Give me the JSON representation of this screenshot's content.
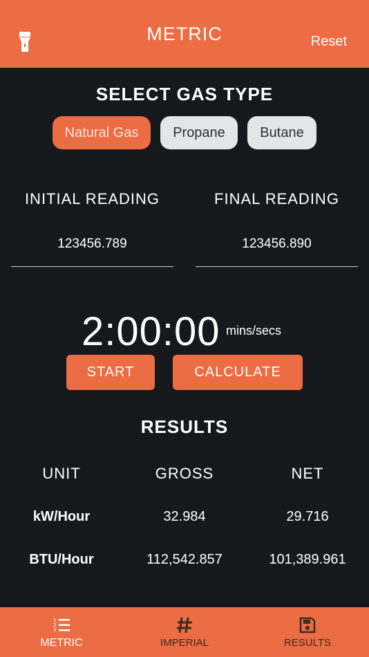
{
  "header": {
    "title": "METRIC",
    "reset_label": "Reset",
    "left_icon": "flashlight-icon"
  },
  "gas": {
    "title": "SELECT GAS TYPE",
    "options": [
      {
        "label": "Natural Gas",
        "selected": true
      },
      {
        "label": "Propane",
        "selected": false
      },
      {
        "label": "Butane",
        "selected": false
      }
    ]
  },
  "readings": {
    "initial_label": "INITIAL READING",
    "initial_value": "123456.789",
    "final_label": "FINAL READING",
    "final_value": "123456.890"
  },
  "timer": {
    "value": "2:00:00",
    "unit": "mins/secs"
  },
  "actions": {
    "start_label": "START",
    "calculate_label": "CALCULATE"
  },
  "results": {
    "title": "RESULTS",
    "headers": [
      "UNIT",
      "GROSS",
      "NET"
    ],
    "rows": [
      {
        "unit": "kW/Hour",
        "gross": "32.984",
        "net": "29.716"
      },
      {
        "unit": "BTU/Hour",
        "gross": "112,542.857",
        "net": "101,389.961"
      }
    ]
  },
  "tabs": [
    {
      "label": "METRIC",
      "icon": "numbered-list-icon",
      "active": true
    },
    {
      "label": "IMPERIAL",
      "icon": "hash-icon",
      "active": false
    },
    {
      "label": "RESULTS",
      "icon": "save-icon",
      "active": false
    }
  ],
  "colors": {
    "accent": "#ec6c43",
    "background": "#16191b",
    "pill_inactive": "#e3e5e6"
  }
}
